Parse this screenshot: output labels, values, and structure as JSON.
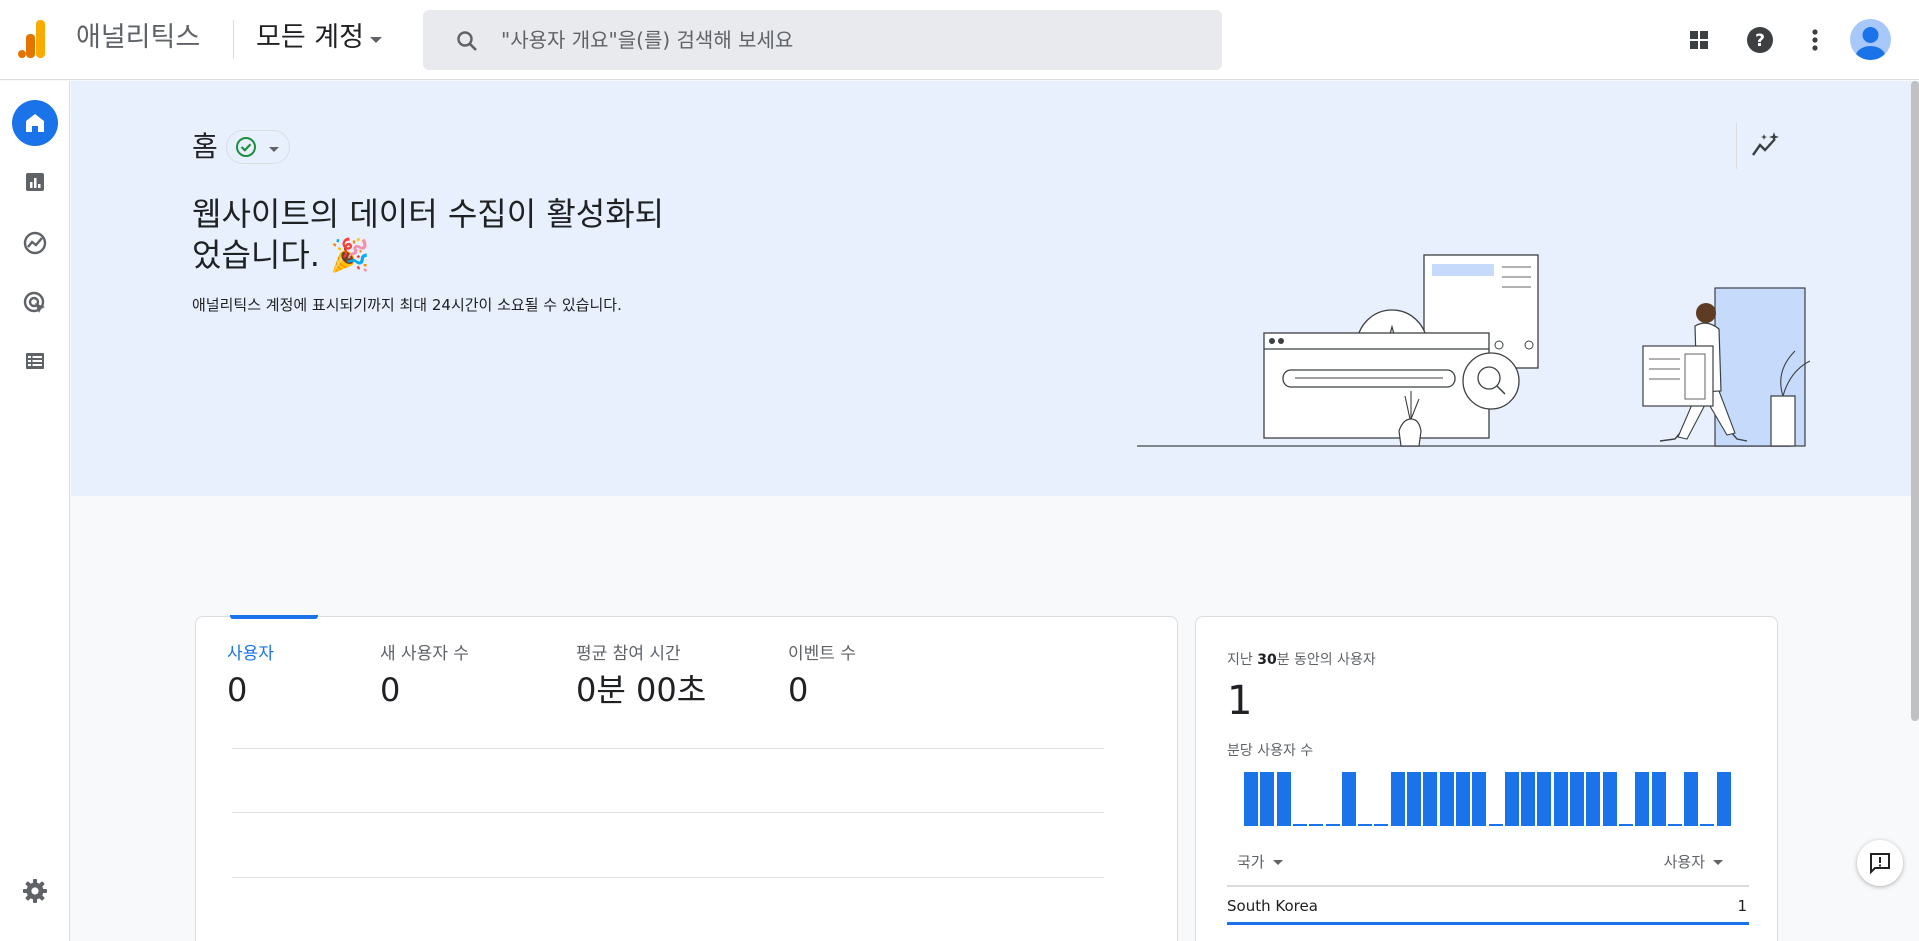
{
  "header": {
    "app_title": "애널리틱스",
    "account_selector": "모든 계정",
    "search_placeholder": "\"사용자 개요\"을(를) 검색해 보세요"
  },
  "icons": {
    "logo": "analytics-logo-icon",
    "search": "search-icon",
    "apps": "apps-grid-icon",
    "help": "help-icon",
    "more": "more-vert-icon",
    "avatar": "account-avatar-icon",
    "nav": [
      "home-icon",
      "reports-icon",
      "explore-icon",
      "advertising-icon",
      "configure-icon"
    ],
    "settings": "gear-icon",
    "insights": "insights-icon",
    "feedback": "feedback-icon"
  },
  "hero": {
    "title": "홈",
    "headline_line1": "웹사이트의 데이터 수집이 활성화되",
    "headline_line2": "었습니다.",
    "emoji": "🎉",
    "subtitle": "애널리틱스 계정에 표시되기까지 최대 24시간이 소요될 수 있습니다."
  },
  "metrics": [
    {
      "label": "사용자",
      "value": "0",
      "selected": true
    },
    {
      "label": "새 사용자 수",
      "value": "0",
      "selected": false
    },
    {
      "label": "평균 참여 시간",
      "value": "0분 00초",
      "selected": false
    },
    {
      "label": "이벤트 수",
      "value": "0",
      "selected": false
    }
  ],
  "realtime": {
    "label_prefix": "지난 ",
    "label_bold": "30",
    "label_suffix": "분 동안의 사용자",
    "value": "1",
    "per_minute_label": "분당 사용자 수",
    "bars": [
      1,
      1,
      1,
      0,
      0,
      0,
      1,
      0,
      0,
      1,
      1,
      1,
      1,
      1,
      1,
      0,
      1,
      1,
      1,
      1,
      1,
      1,
      1,
      0,
      1,
      1,
      0,
      1,
      0,
      1
    ],
    "col_country": "국가",
    "col_users": "사용자",
    "rows": [
      {
        "country": "South Korea",
        "users": "1"
      }
    ]
  },
  "colors": {
    "accent": "#1a73e8",
    "hero_bg": "#e8f0fe",
    "logo_orange": "#f9ab00",
    "logo_dark_orange": "#e37400"
  }
}
